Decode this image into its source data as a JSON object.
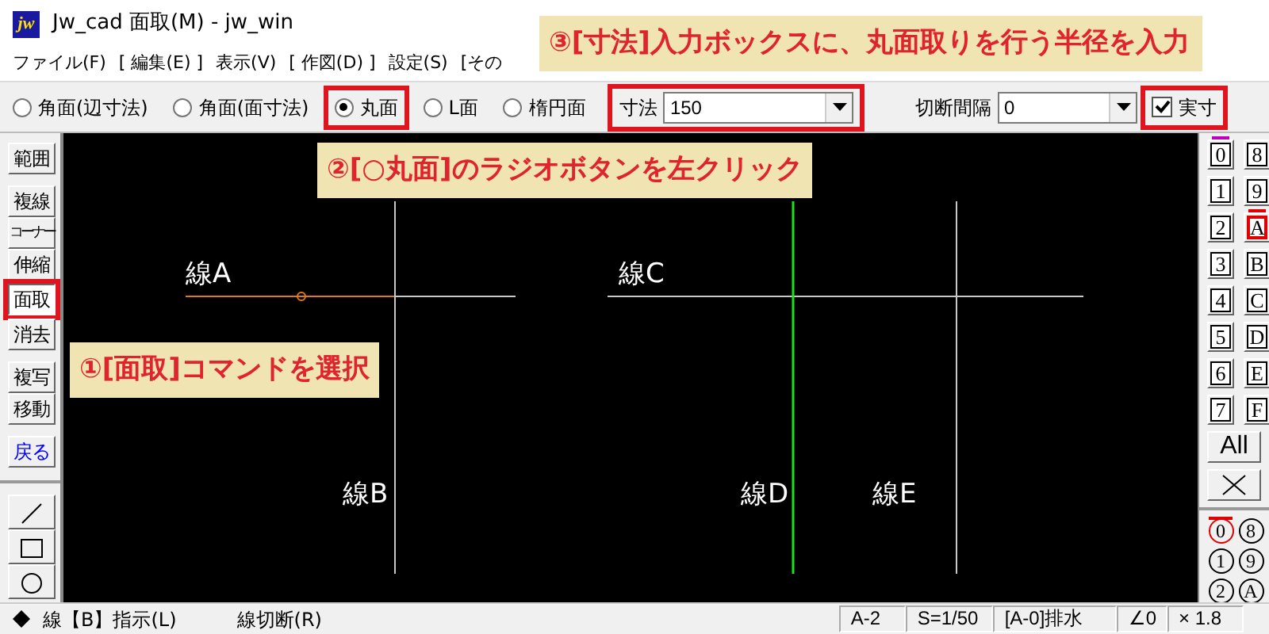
{
  "window": {
    "icon_text": "jw",
    "title": "Jw_cad 面取(M) - jw_win"
  },
  "menu": [
    "ファイル(F)",
    "[ 編集(E) ]",
    "表示(V)",
    "[ 作図(D) ]",
    "設定(S)",
    "[その"
  ],
  "toolbar": {
    "radios": [
      {
        "label": "角面(辺寸法)",
        "selected": false
      },
      {
        "label": "角面(面寸法)",
        "selected": false
      },
      {
        "label": "丸面",
        "selected": true
      },
      {
        "label": "L面",
        "selected": false
      },
      {
        "label": "楕円面",
        "selected": false
      }
    ],
    "dimension": {
      "label": "寸法",
      "value": "150"
    },
    "cut_interval": {
      "label": "切断間隔",
      "value": "0"
    },
    "actual_size": {
      "label": "実寸",
      "checked": true
    }
  },
  "left_tools": [
    [
      {
        "kind": "command",
        "label": "範囲",
        "selected": false
      }
    ],
    [
      {
        "kind": "command",
        "label": "複線",
        "selected": false
      },
      {
        "kind": "command",
        "label": "コーナー",
        "selected": false
      },
      {
        "kind": "command",
        "label": "伸縮",
        "selected": false
      },
      {
        "kind": "command",
        "label": "面取",
        "selected": true
      },
      {
        "kind": "command",
        "label": "消去",
        "selected": false
      }
    ],
    [
      {
        "kind": "command",
        "label": "複写",
        "selected": false
      },
      {
        "kind": "command",
        "label": "移動",
        "selected": false
      }
    ],
    [
      {
        "kind": "undo",
        "label": "戻る",
        "selected": false
      }
    ],
    [
      {
        "kind": "line",
        "selected": false
      },
      {
        "kind": "rect",
        "selected": false
      },
      {
        "kind": "circle",
        "selected": false
      }
    ]
  ],
  "canvas": {
    "labels": [
      "線A",
      "線B",
      "線C",
      "線D",
      "線E"
    ]
  },
  "layers": [
    {
      "label": "0",
      "selected": true,
      "highlighted": false
    },
    {
      "label": "8",
      "selected": false,
      "highlighted": false
    },
    {
      "label": "1",
      "selected": false,
      "highlighted": false
    },
    {
      "label": "9",
      "selected": false,
      "highlighted": false
    },
    {
      "label": "2",
      "selected": false,
      "highlighted": false
    },
    {
      "label": "A",
      "selected": false,
      "highlighted": true
    },
    {
      "label": "3",
      "selected": false,
      "highlighted": false
    },
    {
      "label": "B",
      "selected": false,
      "highlighted": false
    },
    {
      "label": "4",
      "selected": false,
      "highlighted": false
    },
    {
      "label": "C",
      "selected": false,
      "highlighted": false
    },
    {
      "label": "5",
      "selected": false,
      "highlighted": false
    },
    {
      "label": "D",
      "selected": false,
      "highlighted": false
    },
    {
      "label": "6",
      "selected": false,
      "highlighted": false
    },
    {
      "label": "E",
      "selected": false,
      "highlighted": false
    },
    {
      "label": "7",
      "selected": false,
      "highlighted": false
    },
    {
      "label": "F",
      "selected": false,
      "highlighted": false
    }
  ],
  "all_button": "All",
  "layer_groups": [
    {
      "label": "0",
      "selected": true
    },
    {
      "label": "8",
      "selected": false
    },
    {
      "label": "1",
      "selected": false
    },
    {
      "label": "9",
      "selected": false
    },
    {
      "label": "2",
      "selected": false
    },
    {
      "label": "A",
      "selected": false
    }
  ],
  "status_bar": {
    "left": [
      "線【B】指示(L)",
      "線切断(R)"
    ],
    "right": [
      "A-2",
      "S=1/50",
      "[A-0]排水",
      "∠0",
      "× 1.8"
    ]
  },
  "callouts": [
    "①[面取]コマンドを選択",
    "②[○丸面]のラジオボタンを左クリック",
    "③[寸法]入力ボックスに、丸面取りを行う半径を入力"
  ]
}
